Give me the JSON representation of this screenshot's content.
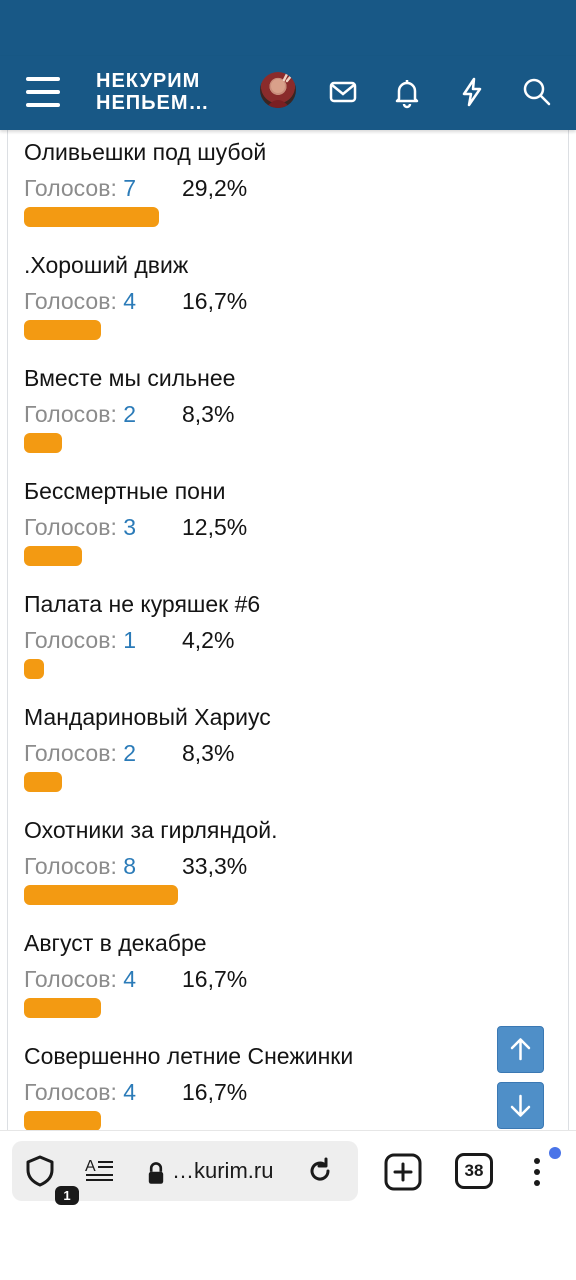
{
  "header": {
    "logo_line1": "НЕКУРИМ",
    "logo_line2": "НЕПЬЕМ…",
    "icons": [
      "menu-icon",
      "avatar",
      "mail-icon",
      "bell-icon",
      "bolt-icon",
      "search-icon"
    ],
    "bg_color": "#185886"
  },
  "poll": {
    "votes_label": "Голосов:",
    "bar_color": "#f39a12",
    "options": [
      {
        "label": "Оливьешки под шубой",
        "votes": "7",
        "percent": "29,2%",
        "fraction": 0.292
      },
      {
        "label": ".Хороший движ",
        "votes": "4",
        "percent": "16,7%",
        "fraction": 0.167
      },
      {
        "label": "Вместе мы сильнее",
        "votes": "2",
        "percent": "8,3%",
        "fraction": 0.083
      },
      {
        "label": "Бессмертные пони",
        "votes": "3",
        "percent": "12,5%",
        "fraction": 0.125
      },
      {
        "label": "Палата не куряшек #6",
        "votes": "1",
        "percent": "4,2%",
        "fraction": 0.042
      },
      {
        "label": "Мандариновый Хариус",
        "votes": "2",
        "percent": "8,3%",
        "fraction": 0.083
      },
      {
        "label": "Охотники за гирляндой.",
        "votes": "8",
        "percent": "33,3%",
        "fraction": 0.333
      },
      {
        "label": "Август в декабре",
        "votes": "4",
        "percent": "16,7%",
        "fraction": 0.167
      },
      {
        "label": "Совершенно летние Снежинки",
        "votes": "4",
        "percent": "16,7%",
        "fraction": 0.167
      }
    ]
  },
  "scroll_buttons": {
    "up_icon": "arrow-up-icon",
    "down_icon": "arrow-down-icon"
  },
  "browser_bar": {
    "shield_badge": "1",
    "url": "…kurim.ru",
    "tab_count": "38",
    "icons": [
      "shield-icon",
      "reader-mode-icon",
      "lock-icon",
      "reload-icon",
      "new-tab-icon",
      "more-icon"
    ]
  }
}
